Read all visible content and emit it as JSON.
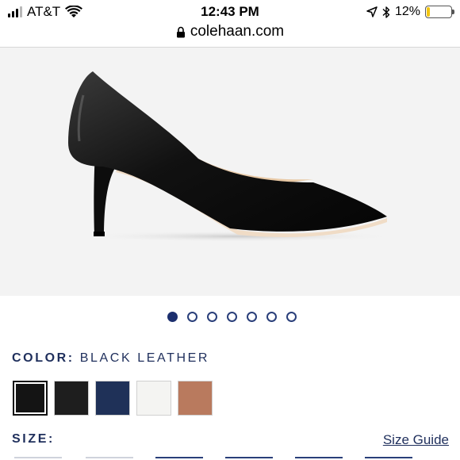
{
  "status_bar": {
    "carrier": "AT&T",
    "time": "12:43 PM",
    "battery_percent": "12%",
    "battery_level": 0.12,
    "icons": [
      "signal-icon",
      "wifi-icon",
      "location-arrow-icon",
      "bluetooth-icon",
      "battery-icon"
    ]
  },
  "browser": {
    "url": "colehaan.com",
    "secure_icon": "lock-icon"
  },
  "product": {
    "image_name": "black-leather-pointed-pump",
    "carousel": {
      "total": 7,
      "active_index": 0
    },
    "color_label": "COLOR:",
    "color_value": "BLACK LEATHER",
    "swatches": [
      {
        "name": "black-leather",
        "color": "#141414",
        "selected": true
      },
      {
        "name": "black-textured",
        "color": "#1e1e1e",
        "selected": false
      },
      {
        "name": "navy",
        "color": "#1f3158",
        "selected": false
      },
      {
        "name": "white",
        "color": "#f4f4f2",
        "selected": false
      },
      {
        "name": "rose-gold",
        "color": "#b97a5e",
        "selected": false
      }
    ],
    "size_label": "SIZE:",
    "size_guide_label": "Size Guide"
  },
  "colors": {
    "brand_navy": "#1f2f5c",
    "dot_active": "#1c2f6e",
    "image_bg": "#f3f3f3"
  }
}
